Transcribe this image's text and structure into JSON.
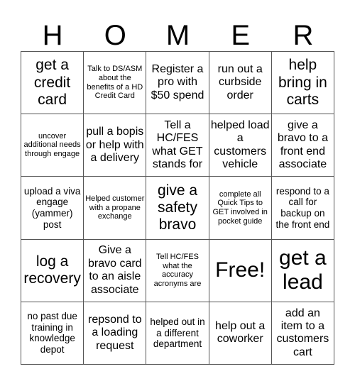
{
  "card": {
    "header_letters": [
      "H",
      "O",
      "M",
      "E",
      "R"
    ],
    "cells": [
      {
        "text": "get a credit card",
        "size": "l"
      },
      {
        "text": "Talk to DS/ASM about the benefits of a HD Credit Card",
        "size": "xs"
      },
      {
        "text": "Register a pro with $50 spend",
        "size": "m"
      },
      {
        "text": "run out a curbside order",
        "size": "m"
      },
      {
        "text": "help bring in carts",
        "size": "l"
      },
      {
        "text": "uncover additional needs through engage",
        "size": "xs"
      },
      {
        "text": "pull a bopis or help with a delivery",
        "size": "m"
      },
      {
        "text": "Tell a HC/FES what GET stands for",
        "size": "m"
      },
      {
        "text": "helped load a customers vehicle",
        "size": "m"
      },
      {
        "text": "give a bravo to a front end associate",
        "size": "m"
      },
      {
        "text": "upload a viva engage (yammer) post",
        "size": "s"
      },
      {
        "text": "Helped customer with a propane exchange",
        "size": "xs"
      },
      {
        "text": "give a safety bravo",
        "size": "l"
      },
      {
        "text": "complete all Quick Tips to GET involved in pocket guide",
        "size": "xs"
      },
      {
        "text": "respond to a call for backup on the front end",
        "size": "s"
      },
      {
        "text": "log a recovery",
        "size": "l"
      },
      {
        "text": "Give a bravo card to an aisle associate",
        "size": "m"
      },
      {
        "text": "Tell HC/FES what the accuracy acronyms are",
        "size": "xs"
      },
      {
        "text": "Free!",
        "size": "xl",
        "free": true
      },
      {
        "text": "get a lead",
        "size": "xl"
      },
      {
        "text": "no past due training in knowledge depot",
        "size": "s"
      },
      {
        "text": "repsond to a loading request",
        "size": "m"
      },
      {
        "text": "helped out in a different department",
        "size": "s"
      },
      {
        "text": "help out a coworker",
        "size": "m"
      },
      {
        "text": "add an item to a customers cart",
        "size": "m"
      }
    ]
  },
  "colors": {
    "grid_line": "#555555",
    "text": "#000000",
    "background": "#ffffff"
  }
}
